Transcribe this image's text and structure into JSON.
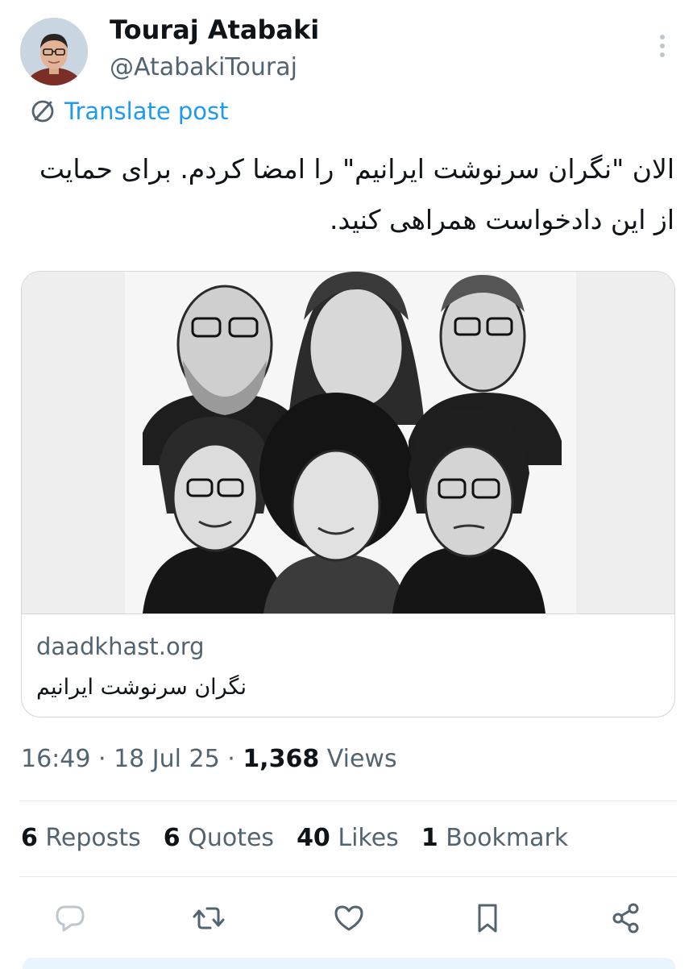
{
  "author": {
    "name": "Touraj Atabaki",
    "handle": "@AtabakiTouraj"
  },
  "translate_label": "Translate post",
  "tweet_text": "الان \"نگران سرنوشت ایرانیم\" را امضا کردم. برای حمایت از این دادخواست همراهی کنید.",
  "card": {
    "domain": "daadkhast.org",
    "title": "نگران سرنوشت ایرانیم"
  },
  "meta": {
    "time": "16:49",
    "date": "18 Jul 25",
    "views_count": "1,368",
    "views_label": "Views"
  },
  "stats": [
    {
      "count": "6",
      "label": "Reposts"
    },
    {
      "count": "6",
      "label": "Quotes"
    },
    {
      "count": "40",
      "label": "Likes"
    },
    {
      "count": "1",
      "label": "Bookmark"
    }
  ],
  "actions": [
    "reply-icon",
    "repost-icon",
    "like-icon",
    "bookmark-icon",
    "share-icon"
  ],
  "colors": {
    "accent": "#1d9bf0",
    "text": "#0f1419",
    "secondary": "#536471",
    "border": "#cfd9de"
  }
}
